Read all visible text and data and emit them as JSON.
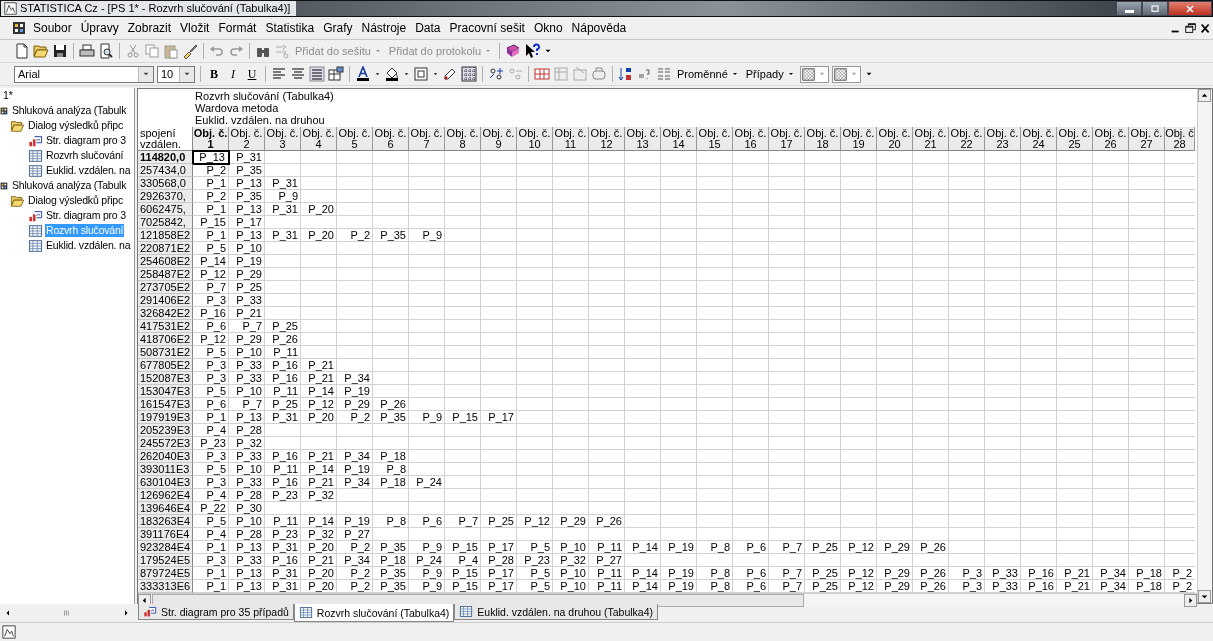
{
  "window": {
    "title": "STATISTICA Cz - [PS 1* - Rozvrh slučování (Tabulka4)]"
  },
  "menu": [
    "Soubor",
    "Úpravy",
    "Zobrazit",
    "Vložit",
    "Formát",
    "Statistika",
    "Grafy",
    "Nástroje",
    "Data",
    "Pracovní sešit",
    "Okno",
    "Nápověda"
  ],
  "toolbar_buttons": [
    {
      "label": "Přidat do sešitu",
      "disabled": true
    },
    {
      "label": "Přidat do protokolu",
      "disabled": true
    }
  ],
  "format_bar": {
    "font": "Arial",
    "size": "10",
    "style_buttons": [
      {
        "label": "B",
        "kind": "bold"
      },
      {
        "label": "I",
        "kind": "italic"
      },
      {
        "label": "U",
        "kind": "underline"
      }
    ],
    "dropdowns": [
      "Proměnné",
      "Případy"
    ]
  },
  "tree": {
    "label": "1*",
    "selected": false,
    "children": [
      {
        "label": "Shluková analýza (Tabulk",
        "kind": "analysis",
        "selected": false,
        "children": [
          {
            "label": "Dialog výsledků připc",
            "kind": "folder",
            "selected": false,
            "children": [
              {
                "label": "Str. diagram pro 3",
                "kind": "graph",
                "selected": false
              },
              {
                "label": "Rozvrh slučování",
                "kind": "table",
                "selected": false
              },
              {
                "label": "Euklid. vzdálen. na",
                "kind": "table",
                "selected": false
              }
            ]
          }
        ]
      },
      {
        "label": "Shluková analýza (Tabulk",
        "kind": "analysis",
        "selected": false,
        "children": [
          {
            "label": "Dialog výsledků připc",
            "kind": "folder",
            "selected": false,
            "children": [
              {
                "label": "Str. diagram pro 3",
                "kind": "graph",
                "selected": false
              },
              {
                "label": "Rozvrh slučování",
                "kind": "table",
                "selected": true
              },
              {
                "label": "Euklid. vzdálen. na",
                "kind": "table",
                "selected": false
              }
            ]
          }
        ]
      }
    ]
  },
  "sheet": {
    "titles": [
      "Rozvrh slučování (Tabulka4)",
      "Wardova metoda",
      "Euklid. vzdálen. na druhou"
    ],
    "corner": [
      "spojení",
      "vzdálen."
    ],
    "columns": [
      {
        "label": "Obj. č.",
        "number": "1",
        "selected": true
      },
      {
        "label": "Obj. č.",
        "number": "2",
        "selected": false
      },
      {
        "label": "Obj. č.",
        "number": "3",
        "selected": false
      },
      {
        "label": "Obj. č.",
        "number": "4",
        "selected": false
      },
      {
        "label": "Obj. č.",
        "number": "5",
        "selected": false
      },
      {
        "label": "Obj. č.",
        "number": "6",
        "selected": false
      },
      {
        "label": "Obj. č.",
        "number": "7",
        "selected": false
      },
      {
        "label": "Obj. č.",
        "number": "8",
        "selected": false
      },
      {
        "label": "Obj. č.",
        "number": "9",
        "selected": false
      },
      {
        "label": "Obj. č.",
        "number": "10",
        "selected": false
      },
      {
        "label": "Obj. č.",
        "number": "11",
        "selected": false
      },
      {
        "label": "Obj. č.",
        "number": "12",
        "selected": false
      },
      {
        "label": "Obj. č.",
        "number": "13",
        "selected": false
      },
      {
        "label": "Obj. č.",
        "number": "14",
        "selected": false
      },
      {
        "label": "Obj. č.",
        "number": "15",
        "selected": false
      },
      {
        "label": "Obj. č.",
        "number": "16",
        "selected": false
      },
      {
        "label": "Obj. č.",
        "number": "17",
        "selected": false
      },
      {
        "label": "Obj. č.",
        "number": "18",
        "selected": false
      },
      {
        "label": "Obj. č.",
        "number": "19",
        "selected": false
      },
      {
        "label": "Obj. č.",
        "number": "20",
        "selected": false
      },
      {
        "label": "Obj. č.",
        "number": "21",
        "selected": false
      },
      {
        "label": "Obj. č.",
        "number": "22",
        "selected": false
      },
      {
        "label": "Obj. č.",
        "number": "23",
        "selected": false
      },
      {
        "label": "Obj. č.",
        "number": "24",
        "selected": false
      },
      {
        "label": "Obj. č.",
        "number": "25",
        "selected": false
      },
      {
        "label": "Obj. č.",
        "number": "26",
        "selected": false
      },
      {
        "label": "Obj. č.",
        "number": "27",
        "selected": false
      },
      {
        "label": "Obj. č",
        "number": "28",
        "selected": false
      }
    ],
    "rows": [
      {
        "label": "114820,0",
        "selected": true,
        "cells": [
          "P_13",
          "P_31"
        ]
      },
      {
        "label": "257434,0",
        "selected": false,
        "cells": [
          "P_2",
          "P_35"
        ]
      },
      {
        "label": "330568,0",
        "selected": false,
        "cells": [
          "P_1",
          "P_13",
          "P_31"
        ]
      },
      {
        "label": "2926370,",
        "selected": false,
        "cells": [
          "P_2",
          "P_35",
          "P_9"
        ]
      },
      {
        "label": "6062475,",
        "selected": false,
        "cells": [
          "P_1",
          "P_13",
          "P_31",
          "P_20"
        ]
      },
      {
        "label": "7025842,",
        "selected": false,
        "cells": [
          "P_15",
          "P_17"
        ]
      },
      {
        "label": "121858E2",
        "selected": false,
        "cells": [
          "P_1",
          "P_13",
          "P_31",
          "P_20",
          "P_2",
          "P_35",
          "P_9"
        ]
      },
      {
        "label": "220871E2",
        "selected": false,
        "cells": [
          "P_5",
          "P_10"
        ]
      },
      {
        "label": "254608E2",
        "selected": false,
        "cells": [
          "P_14",
          "P_19"
        ]
      },
      {
        "label": "258487E2",
        "selected": false,
        "cells": [
          "P_12",
          "P_29"
        ]
      },
      {
        "label": "273705E2",
        "selected": false,
        "cells": [
          "P_7",
          "P_25"
        ]
      },
      {
        "label": "291406E2",
        "selected": false,
        "cells": [
          "P_3",
          "P_33"
        ]
      },
      {
        "label": "326842E2",
        "selected": false,
        "cells": [
          "P_16",
          "P_21"
        ]
      },
      {
        "label": "417531E2",
        "selected": false,
        "cells": [
          "P_6",
          "P_7",
          "P_25"
        ]
      },
      {
        "label": "418706E2",
        "selected": false,
        "cells": [
          "P_12",
          "P_29",
          "P_26"
        ]
      },
      {
        "label": "508731E2",
        "selected": false,
        "cells": [
          "P_5",
          "P_10",
          "P_11"
        ]
      },
      {
        "label": "677805E2",
        "selected": false,
        "cells": [
          "P_3",
          "P_33",
          "P_16",
          "P_21"
        ]
      },
      {
        "label": "152087E3",
        "selected": false,
        "cells": [
          "P_3",
          "P_33",
          "P_16",
          "P_21",
          "P_34"
        ]
      },
      {
        "label": "153047E3",
        "selected": false,
        "cells": [
          "P_5",
          "P_10",
          "P_11",
          "P_14",
          "P_19"
        ]
      },
      {
        "label": "161547E3",
        "selected": false,
        "cells": [
          "P_6",
          "P_7",
          "P_25",
          "P_12",
          "P_29",
          "P_26"
        ]
      },
      {
        "label": "197919E3",
        "selected": false,
        "cells": [
          "P_1",
          "P_13",
          "P_31",
          "P_20",
          "P_2",
          "P_35",
          "P_9",
          "P_15",
          "P_17"
        ]
      },
      {
        "label": "205239E3",
        "selected": false,
        "cells": [
          "P_4",
          "P_28"
        ]
      },
      {
        "label": "245572E3",
        "selected": false,
        "cells": [
          "P_23",
          "P_32"
        ]
      },
      {
        "label": "262040E3",
        "selected": false,
        "cells": [
          "P_3",
          "P_33",
          "P_16",
          "P_21",
          "P_34",
          "P_18"
        ]
      },
      {
        "label": "393011E3",
        "selected": false,
        "cells": [
          "P_5",
          "P_10",
          "P_11",
          "P_14",
          "P_19",
          "P_8"
        ]
      },
      {
        "label": "630104E3",
        "selected": false,
        "cells": [
          "P_3",
          "P_33",
          "P_16",
          "P_21",
          "P_34",
          "P_18",
          "P_24"
        ]
      },
      {
        "label": "126962E4",
        "selected": false,
        "cells": [
          "P_4",
          "P_28",
          "P_23",
          "P_32"
        ]
      },
      {
        "label": "139646E4",
        "selected": false,
        "cells": [
          "P_22",
          "P_30"
        ]
      },
      {
        "label": "183263E4",
        "selected": false,
        "cells": [
          "P_5",
          "P_10",
          "P_11",
          "P_14",
          "P_19",
          "P_8",
          "P_6",
          "P_7",
          "P_25",
          "P_12",
          "P_29",
          "P_26"
        ]
      },
      {
        "label": "391176E4",
        "selected": false,
        "cells": [
          "P_4",
          "P_28",
          "P_23",
          "P_32",
          "P_27"
        ]
      },
      {
        "label": "923284E4",
        "selected": false,
        "cells": [
          "P_1",
          "P_13",
          "P_31",
          "P_20",
          "P_2",
          "P_35",
          "P_9",
          "P_15",
          "P_17",
          "P_5",
          "P_10",
          "P_11",
          "P_14",
          "P_19",
          "P_8",
          "P_6",
          "P_7",
          "P_25",
          "P_12",
          "P_29",
          "P_26"
        ]
      },
      {
        "label": "179524E5",
        "selected": false,
        "cells": [
          "P_3",
          "P_33",
          "P_16",
          "P_21",
          "P_34",
          "P_18",
          "P_24",
          "P_4",
          "P_28",
          "P_23",
          "P_32",
          "P_27"
        ]
      },
      {
        "label": "879724E5",
        "selected": false,
        "cells": [
          "P_1",
          "P_13",
          "P_31",
          "P_20",
          "P_2",
          "P_35",
          "P_9",
          "P_15",
          "P_17",
          "P_5",
          "P_10",
          "P_11",
          "P_14",
          "P_19",
          "P_8",
          "P_6",
          "P_7",
          "P_25",
          "P_12",
          "P_29",
          "P_26",
          "P_3",
          "P_33",
          "P_16",
          "P_21",
          "P_34",
          "P_18",
          "P_2"
        ]
      },
      {
        "label": "333313E6",
        "selected": false,
        "cells": [
          "P_1",
          "P_13",
          "P_31",
          "P_20",
          "P_2",
          "P_35",
          "P_9",
          "P_15",
          "P_17",
          "P_5",
          "P_10",
          "P_11",
          "P_14",
          "P_19",
          "P_8",
          "P_6",
          "P_7",
          "P_25",
          "P_12",
          "P_29",
          "P_26",
          "P_3",
          "P_33",
          "P_16",
          "P_21",
          "P_34",
          "P_18",
          "P_2"
        ]
      }
    ]
  },
  "tabs": [
    {
      "label": "Str. diagram pro 35 případů",
      "kind": "graph",
      "selected": false
    },
    {
      "label": "Rozvrh slučování (Tabulka4)",
      "kind": "table",
      "selected": true
    },
    {
      "label": "Euklid. vzdálen. na druhou (Tabulka4)",
      "kind": "table",
      "selected": false
    }
  ]
}
